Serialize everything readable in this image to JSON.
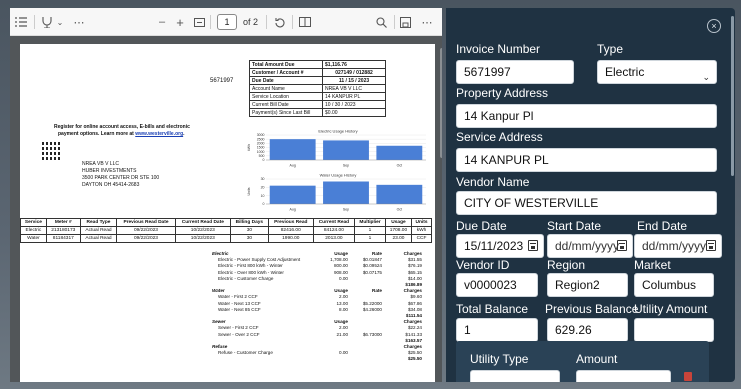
{
  "viewer": {
    "toolbar": {
      "page_current": "1",
      "page_of": "of 2",
      "zoom_out": "–",
      "zoom_in": "+"
    },
    "bill": {
      "account_number_display": "5671997",
      "summary": [
        {
          "label": "Total Amount Due",
          "value": "$1,116.76"
        },
        {
          "label": "Customer / Account #",
          "value": "027149 / 012882"
        },
        {
          "label": "Due Date",
          "value": "11 / 15 / 2023"
        },
        {
          "label": "Account Name",
          "value": "NREA VB V LLC"
        },
        {
          "label": "Service Location",
          "value": "14 KANPUR PL"
        },
        {
          "label": "Current Bill Date",
          "value": "10 / 30 / 2023"
        },
        {
          "label": "Payment(s) Since Last Bill",
          "value": "$0.00"
        }
      ],
      "register_line1": "Register for online account access, E-bills and electronic",
      "register_line2": "payment options. Learn more at",
      "register_link": "www.westerville.org",
      "address": [
        "NREA VB V LLC",
        "HUBER INVESTMENTS",
        "3500 PARK CENTER DR STE 100",
        "DAYTON OH 45414-2683"
      ],
      "service_headers": [
        "Service",
        "Meter #",
        "Read Type",
        "Previous Read Date",
        "Current Read Date",
        "Billing Days",
        "Previous Read",
        "Current Read",
        "Multiplier",
        "Usage",
        "Units"
      ],
      "service_rows": [
        [
          "Electric",
          "213180173",
          "Actual Read",
          "09/22/2023",
          "10/22/2023",
          "30",
          "82416.00",
          "84124.00",
          "1",
          "1708.00",
          "kWh"
        ],
        [
          "Water",
          "81184317",
          "Actual Read",
          "09/22/2023",
          "10/22/2023",
          "30",
          "1990.00",
          "2013.00",
          "1",
          "23.00",
          "CCF"
        ]
      ],
      "charges": [
        {
          "kind": "section",
          "name": "Electric",
          "usage": "Usage",
          "rate": "Rate",
          "charges": "Charges"
        },
        {
          "kind": "item",
          "name": "Electric - Power Supply Cost Adjustment",
          "usage": "1,708.00",
          "rate": "$0.01847",
          "charges": "$31.55"
        },
        {
          "kind": "item",
          "name": "Electric - First 800 kWh - Winter",
          "usage": "800.00",
          "rate": "$0.09524",
          "charges": "$76.19"
        },
        {
          "kind": "item",
          "name": "Electric - Over 800 kWh - Winter",
          "usage": "908.00",
          "rate": "$0.07175",
          "charges": "$65.15"
        },
        {
          "kind": "item",
          "name": "Electric - Customer Charge",
          "usage": "0.00",
          "rate": "",
          "charges": "$14.00"
        },
        {
          "kind": "total",
          "name": "",
          "usage": "",
          "rate": "",
          "charges": "$186.89"
        },
        {
          "kind": "section",
          "name": "Water",
          "usage": "Usage",
          "rate": "Rate",
          "charges": "Charges"
        },
        {
          "kind": "item",
          "name": "Water - First 2 CCF",
          "usage": "2.00",
          "rate": "",
          "charges": "$9.60"
        },
        {
          "kind": "item",
          "name": "Water - Next 13 CCF",
          "usage": "13.00",
          "rate": "$5.22000",
          "charges": "$67.86"
        },
        {
          "kind": "item",
          "name": "Water - Next 85 CCF",
          "usage": "8.00",
          "rate": "$4.26000",
          "charges": "$34.08"
        },
        {
          "kind": "total",
          "name": "",
          "usage": "",
          "rate": "",
          "charges": "$111.54"
        },
        {
          "kind": "section",
          "name": "Sewer",
          "usage": "Usage",
          "rate": "",
          "charges": "Charges"
        },
        {
          "kind": "item",
          "name": "Sewer - First 2 CCF",
          "usage": "2.00",
          "rate": "",
          "charges": "$22.24"
        },
        {
          "kind": "item",
          "name": "Sewer - Over 2 CCF",
          "usage": "21.00",
          "rate": "$6.73000",
          "charges": "$141.33"
        },
        {
          "kind": "total",
          "name": "",
          "usage": "",
          "rate": "",
          "charges": "$163.57"
        },
        {
          "kind": "section",
          "name": "Refuse",
          "usage": "",
          "rate": "",
          "charges": "Charges"
        },
        {
          "kind": "item",
          "name": "Refuse - Customer Charge",
          "usage": "0.00",
          "rate": "",
          "charges": "$25.50"
        },
        {
          "kind": "total",
          "name": "",
          "usage": "",
          "rate": "",
          "charges": "$25.50"
        }
      ]
    }
  },
  "chart_data": [
    {
      "type": "bar",
      "title": "Electric Usage History",
      "categories": [
        "Aug",
        "Sep",
        "Oct"
      ],
      "values": [
        2500,
        2350,
        1708
      ],
      "ylabel": "kWh",
      "ylim": [
        0,
        3000
      ],
      "yticks": [
        "3000",
        "2500",
        "2000",
        "1500",
        "1000",
        "500",
        "0"
      ],
      "color": "#4a7fd6"
    },
    {
      "type": "bar",
      "title": "Water Usage History",
      "categories": [
        "Aug",
        "Sep",
        "Oct"
      ],
      "values": [
        22,
        27,
        23
      ],
      "ylabel": "Units",
      "ylim": [
        0,
        30
      ],
      "yticks": [
        "30",
        "20",
        "10",
        "0"
      ],
      "color": "#4a7fd6"
    }
  ],
  "form": {
    "invoice_number_label": "Invoice Number",
    "invoice_number": "5671997",
    "type_label": "Type",
    "type_value": "Electric",
    "property_address_label": "Property Address",
    "property_address": "14 Kanpur Pl",
    "service_address_label": "Service Address",
    "service_address": "14 KANPUR PL",
    "vendor_name_label": "Vendor Name",
    "vendor_name": "CITY OF WESTERVILLE",
    "due_date_label": "Due Date",
    "due_date": "15/11/2023",
    "start_date_label": "Start Date",
    "start_date_placeholder": "dd/mm/yyyy",
    "end_date_label": "End Date",
    "end_date_placeholder": "dd/mm/yyyy",
    "vendor_id_label": "Vendor ID",
    "vendor_id": "v0000023",
    "region_label": "Region",
    "region": "Region2",
    "market_label": "Market",
    "market": "Columbus",
    "total_balance_label": "Total Balance",
    "total_balance": "1",
    "previous_balance_label": "Previous Balance",
    "previous_balance": "629.26",
    "utility_amount_label": "Utility Amount",
    "utility_amount": "",
    "utility_type_label": "Utility Type",
    "amount_label": "Amount",
    "close_symbol": "×"
  }
}
